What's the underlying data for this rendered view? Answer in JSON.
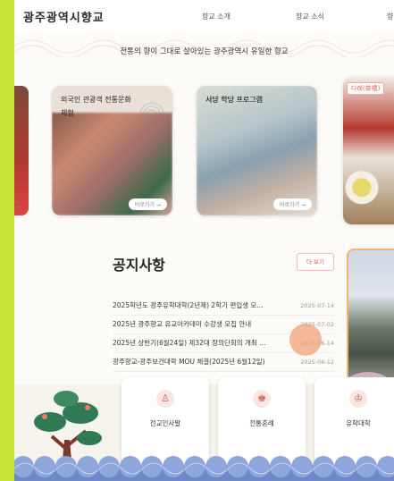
{
  "header": {
    "logo": "광주광역시향교",
    "nav": [
      "향교 소개",
      "향교 소식",
      "향"
    ]
  },
  "tagline": "전통의 향이 그대로 살아있는 광주광역시 유일한 향교",
  "cards": [
    {
      "title_line1": "외국인 관광객 전통문화",
      "title_line2": "체험",
      "button": "바로가기 →"
    },
    {
      "title_line1": "서당 학당 프로그램",
      "title_line2": "",
      "button": "바로가기 →"
    }
  ],
  "side_card": {
    "tag": "다례(茶禮)"
  },
  "left_card": {
    "button": "→"
  },
  "notice": {
    "title": "공지사항",
    "more": "더 보기",
    "items": [
      {
        "text": "2025학년도 광주유학대학(2년제) 2학기 편입생 모...",
        "date": "2025-07-14"
      },
      {
        "text": "2025년 광주향교 유교아카데미 수강생 모집 안내",
        "date": "2025-07-02"
      },
      {
        "text": "2025년 상반기(6월24일) 제32대 장의단회의 개최 ...",
        "date": "2025-06-14"
      },
      {
        "text": "광주향교-광주보건대학 MOU 체결(2025년 6월12일)",
        "date": "2025-06-12"
      }
    ]
  },
  "quick_links": [
    {
      "label": "전교인사말",
      "icon": "person-icon"
    },
    {
      "label": "전통혼례",
      "icon": "wedding-icon"
    },
    {
      "label": "유학대학",
      "icon": "scholar-icon"
    }
  ],
  "colors": {
    "accent": "#e0604f",
    "frame": "#c8e43a"
  }
}
